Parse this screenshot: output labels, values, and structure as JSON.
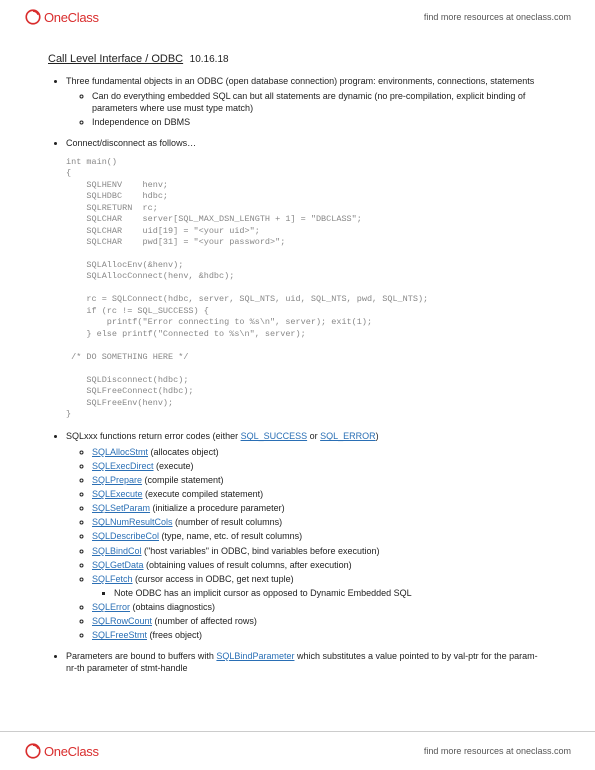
{
  "brand": {
    "logo_text": "OneClass",
    "tagline": "find more resources at oneclass.com"
  },
  "doc": {
    "title": "Call Level Interface / ODBC",
    "date": "10.16.18",
    "intro": "Three fundamental objects in an ODBC (open database connection) program: environments, connections, statements",
    "intro_sub1": "Can do everything embedded SQL can but all statements are dynamic (no pre-compilation, explicit binding of parameters where use must type match)",
    "intro_sub2": "Independence on DBMS",
    "connect_heading": "Connect/disconnect as follows…",
    "code": "int main()\n{\n    SQLHENV    henv;\n    SQLHDBC    hdbc;\n    SQLRETURN  rc;\n    SQLCHAR    server[SQL_MAX_DSN_LENGTH + 1] = \"DBCLASS\";\n    SQLCHAR    uid[19] = \"<your uid>\";\n    SQLCHAR    pwd[31] = \"<your password>\";\n\n    SQLAllocEnv(&henv);\n    SQLAllocConnect(henv, &hdbc);\n\n    rc = SQLConnect(hdbc, server, SQL_NTS, uid, SQL_NTS, pwd, SQL_NTS);\n    if (rc != SQL_SUCCESS) {\n        printf(\"Error connecting to %s\\n\", server); exit(1);\n    } else printf(\"Connected to %s\\n\", server);\n\n /* DO SOMETHING HERE */\n\n    SQLDisconnect(hdbc);\n    SQLFreeConnect(hdbc);\n    SQLFreeEnv(henv);\n}",
    "funcs": {
      "lead_a": "SQLxxx functions return error codes (either ",
      "kw_success": "SQL_SUCCESS",
      "lead_b": " or ",
      "kw_error": "SQL_ERROR",
      "lead_c": ")",
      "items": [
        {
          "name": "SQLAllocStmt",
          "desc": " (allocates object)"
        },
        {
          "name": "SQLExecDirect",
          "desc": " (execute)"
        },
        {
          "name": "SQLPrepare",
          "desc": " (compile statement)"
        },
        {
          "name": "SQLExecute",
          "desc": " (execute compiled statement)"
        },
        {
          "name": "SQLSetParam",
          "desc": " (initialize a procedure parameter)"
        },
        {
          "name": "SQLNumResultCols",
          "desc": " (number of result columns)"
        },
        {
          "name": "SQLDescribeCol",
          "desc": " (type, name, etc. of result columns)"
        },
        {
          "name": "SQLBindCol",
          "desc": " (\"host variables\" in ODBC, bind variables before execution)"
        },
        {
          "name": "SQLGetData",
          "desc": " (obtaining values of result columns, after execution)"
        },
        {
          "name": "SQLFetch",
          "desc": " (cursor access in ODBC, get next tuple)"
        },
        {
          "name": "SQLError",
          "desc": " (obtains diagnostics)"
        },
        {
          "name": "SQLRowCount",
          "desc": " (number of affected rows)"
        },
        {
          "name": "SQLFreeStmt",
          "desc": " (frees object)"
        }
      ],
      "fetch_note": "Note ODBC has an implicit cursor as opposed to Dynamic Embedded SQL"
    },
    "params": {
      "a": "Parameters are bound to buffers with ",
      "kw": "SQLBindParameter",
      "b": " which substitutes a value pointed to by val-ptr for the param-nr-th parameter of stmt-handle"
    }
  }
}
